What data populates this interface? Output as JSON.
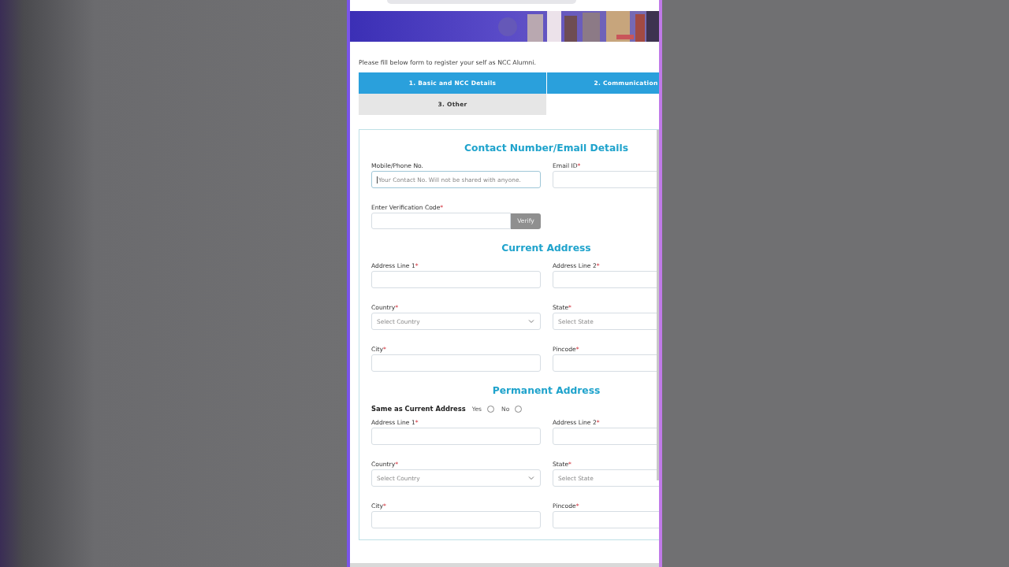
{
  "intro": "Please fill below form to register your self as NCC Alumni.",
  "tabs": [
    {
      "label": "1. Basic and NCC Details",
      "selected": true
    },
    {
      "label": "2. Communication",
      "selected": true
    },
    {
      "label": "3. Other",
      "selected": false
    }
  ],
  "sections": [
    {
      "title": "Contact Number/Email Details",
      "fields": [
        {
          "kind": "text",
          "label": "Mobile/Phone No.",
          "placeholder": "Your Contact No. Will not be shared with anyone.",
          "focused": true
        },
        {
          "kind": "text",
          "label": "Email ID",
          "asterisk": "*"
        },
        {
          "kind": "verify",
          "label": "Enter Verification Code",
          "asterisk": "*",
          "button": "Verify"
        }
      ]
    },
    {
      "title": "Current Address",
      "fields": [
        {
          "kind": "text",
          "label": "Address Line 1",
          "asterisk": "*"
        },
        {
          "kind": "text",
          "label": "Address Line 2",
          "asterisk": "*"
        },
        {
          "kind": "select",
          "label": "Country",
          "asterisk": "*",
          "placeholder": "Select Country",
          "chevron": true
        },
        {
          "kind": "select",
          "label": "State",
          "asterisk": "*",
          "placeholder": "Select State"
        },
        {
          "kind": "text",
          "label": "City",
          "asterisk": "*"
        },
        {
          "kind": "text",
          "label": "Pincode",
          "asterisk": "*"
        }
      ]
    },
    {
      "title": "Permanent Address",
      "same_as": {
        "label": "Same as Current Address",
        "options": [
          {
            "label": "Yes",
            "selected": false
          },
          {
            "label": "No",
            "selected": false
          }
        ]
      },
      "fields": [
        {
          "kind": "text",
          "label": "Address Line 1",
          "asterisk": "*"
        },
        {
          "kind": "text",
          "label": "Address Line 2",
          "asterisk": "*"
        },
        {
          "kind": "select",
          "label": "Country",
          "asterisk": "*",
          "placeholder": "Select Country",
          "chevron": true
        },
        {
          "kind": "select",
          "label": "State",
          "asterisk": "*",
          "placeholder": "Select State"
        },
        {
          "kind": "text",
          "label": "City",
          "asterisk": "*"
        },
        {
          "kind": "text",
          "label": "Pincode",
          "asterisk": "*"
        }
      ]
    }
  ]
}
